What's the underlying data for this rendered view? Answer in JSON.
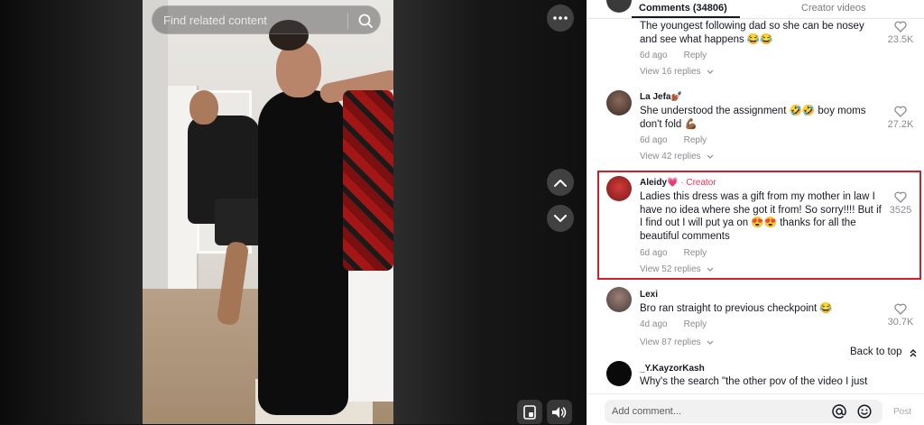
{
  "search": {
    "placeholder": "Find related content"
  },
  "tabs": {
    "comments": "Comments (34806)",
    "creator_videos": "Creator videos"
  },
  "comments": [
    {
      "text": "The youngest following dad so she can be nosey and see what happens 😂😂",
      "likes": "23.5K",
      "age": "6d ago",
      "reply": "Reply",
      "view_replies": "View 16 replies"
    },
    {
      "name": "La Jefa💅🏾",
      "text": "She understood the assignment 🤣🤣 boy moms don't fold 💪🏾",
      "likes": "27.2K",
      "age": "6d ago",
      "reply": "Reply",
      "view_replies": "View 42 replies"
    },
    {
      "name": "Aleidy💗",
      "badge": "· Creator",
      "text": "Ladies this dress was a gift from my mother in law I have no idea where she got it from! So sorry!!!! But if I find out I will put ya on 😍😍 thanks for all the beautiful comments",
      "likes": "3525",
      "age": "6d ago",
      "reply": "Reply",
      "view_replies": "View 52 replies"
    },
    {
      "name": "Lexi",
      "text": "Bro ran straight to previous checkpoint 😂",
      "likes": "30.7K",
      "age": "4d ago",
      "reply": "Reply",
      "view_replies": "View 87 replies"
    },
    {
      "name": "_Y.KayzorKash",
      "text": "Why's the search \"the other pov of the video I just"
    }
  ],
  "back_to_top": "Back to top",
  "add_comment": {
    "placeholder": "Add comment...",
    "post": "Post"
  },
  "colors": {
    "creator_badge": "#fe2c55",
    "highlight": "#d01f2a",
    "text": "#161823",
    "meta": "#8a8b91"
  }
}
